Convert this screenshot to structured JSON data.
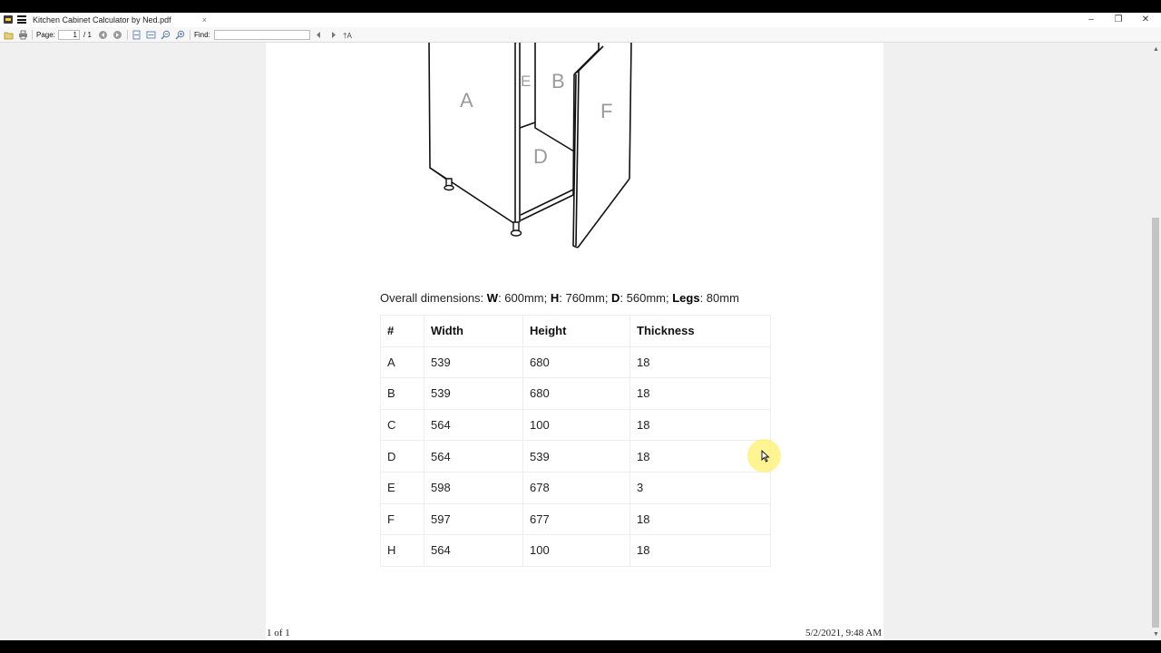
{
  "window": {
    "tab_title": "Kitchen Cabinet Calculator by Ned.pdf",
    "tab_close": "×",
    "minimize": "–",
    "restore": "❐",
    "close": "✕"
  },
  "toolbar": {
    "page_label": "Page:",
    "page_current": "1",
    "page_total": "/ 1",
    "find_label": "Find:",
    "find_value": "",
    "icons": [
      "open-icon",
      "print-icon",
      "previous-page-icon",
      "next-page-icon",
      "fit-page-icon",
      "fit-width-icon",
      "zoom-out-icon",
      "zoom-in-icon",
      "find-previous-icon",
      "find-next-icon",
      "match-case-icon"
    ]
  },
  "drawing": {
    "panel_labels": [
      "A",
      "E",
      "B",
      "F",
      "D"
    ],
    "label_color": "#9a9a9a"
  },
  "document": {
    "dims": {
      "prefix": "Overall dimensions: ",
      "w_key": "W",
      "w_val": ": 600mm; ",
      "h_key": "H",
      "h_val": ": 760mm; ",
      "d_key": "D",
      "d_val": ": 560mm; ",
      "legs_key": "Legs",
      "legs_val": ": 80mm"
    },
    "table": {
      "headers": [
        "#",
        "Width",
        "Height",
        "Thickness"
      ],
      "rows": [
        [
          "A",
          "539",
          "680",
          "18"
        ],
        [
          "B",
          "539",
          "680",
          "18"
        ],
        [
          "C",
          "564",
          "100",
          "18"
        ],
        [
          "D",
          "564",
          "539",
          "18"
        ],
        [
          "E",
          "598",
          "678",
          "3"
        ],
        [
          "F",
          "597",
          "677",
          "18"
        ],
        [
          "H",
          "564",
          "100",
          "18"
        ]
      ]
    }
  },
  "footer": {
    "page_count": "1 of 1",
    "timestamp": "5/2/2021, 9:48 AM"
  },
  "colors": {
    "highlight": "#fff06e",
    "scroll_thumb": "#c4c4c4"
  }
}
